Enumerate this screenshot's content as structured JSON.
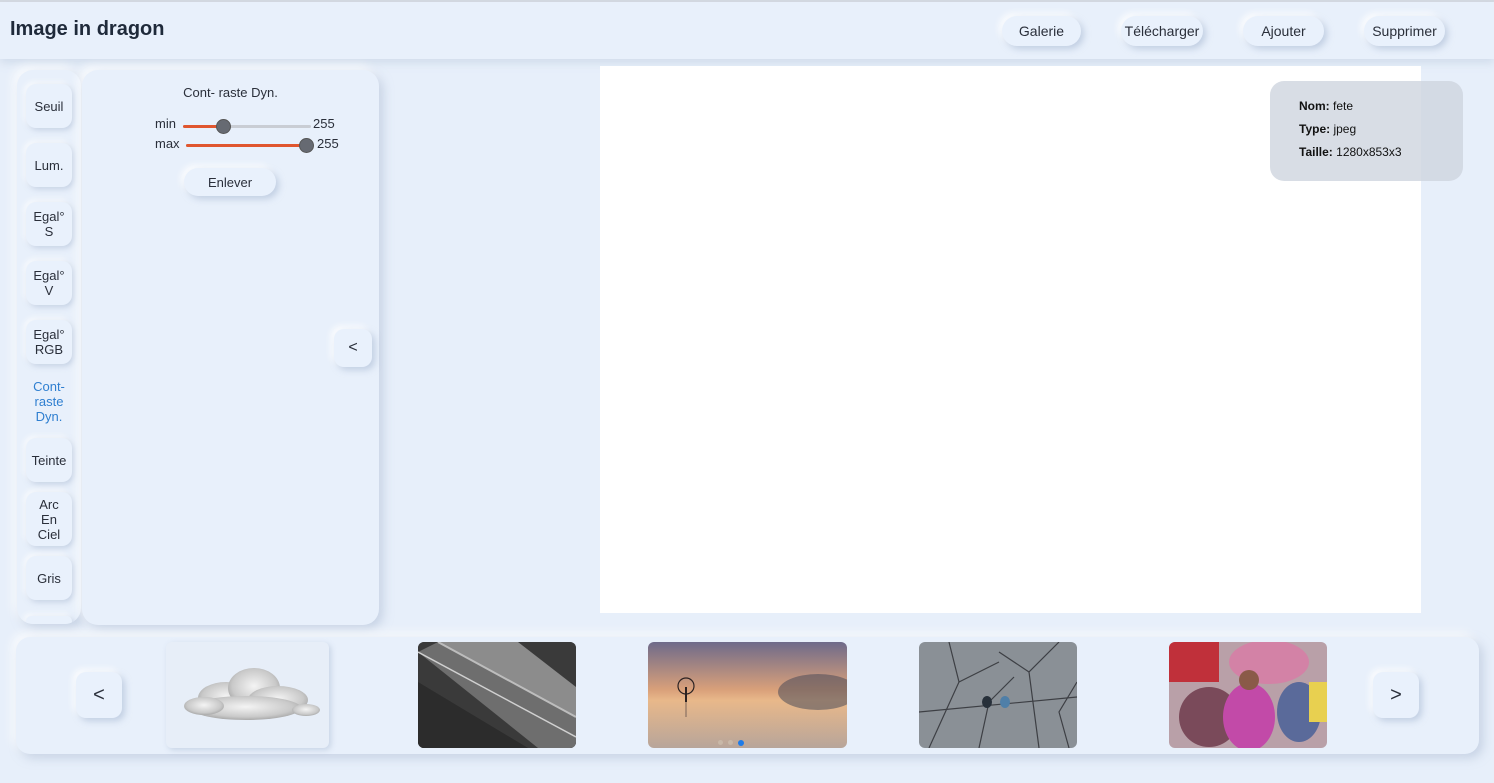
{
  "header": {
    "title": "Image in dragon",
    "buttons": [
      "Galerie",
      "Télécharger",
      "Ajouter",
      "Supprimer"
    ]
  },
  "sidebar": {
    "items": [
      {
        "label": "Seuil"
      },
      {
        "label": "Lum."
      },
      {
        "label": "Egal°\nS"
      },
      {
        "label": "Egal°\nV"
      },
      {
        "label": "Egal°\nRGB"
      },
      {
        "label": "Cont-\nraste\nDyn.",
        "active": true
      },
      {
        "label": "Teinte"
      },
      {
        "label": "Arc\nEn\nCiel"
      },
      {
        "label": "Gris"
      }
    ]
  },
  "panel": {
    "title": "Cont- raste Dyn.",
    "min": {
      "label": "min",
      "value": "255",
      "level": 0.32
    },
    "max": {
      "label": "max",
      "value": "255",
      "level": 1.0
    },
    "remove_label": "Enlever",
    "collapse_label": "<"
  },
  "info": {
    "nom_label": "Nom:",
    "nom": "fete",
    "type_label": "Type:",
    "type": "jpeg",
    "taille_label": "Taille:",
    "taille": "1280x853x3"
  },
  "gallery": {
    "prev_label": "<",
    "next_label": ">",
    "thumbnails": [
      "cloud",
      "stairs",
      "lake-tree",
      "birds-branches",
      "holi-festival"
    ],
    "dots": 3,
    "active_dot": 2
  },
  "colors": {
    "background": "#e7effa",
    "accent": "#e0562f",
    "active_text": "#2f7fd0"
  }
}
